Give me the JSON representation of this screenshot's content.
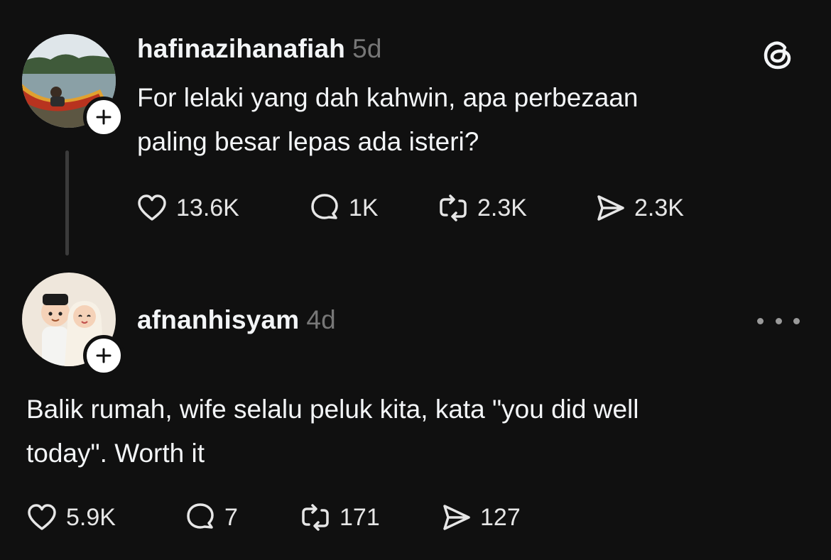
{
  "posts": [
    {
      "username": "hafinazihanafiah",
      "time": "5d",
      "text_lines": [
        "For lelaki yang dah kahwin, apa perbezaan",
        "paling besar lepas ada isteri?"
      ],
      "likes": "13.6K",
      "replies": "1K",
      "reposts": "2.3K",
      "shares": "2.3K"
    },
    {
      "username": "afnanhisyam",
      "time": "4d",
      "text_lines": [
        "Balik rumah, wife selalu peluk kita, kata \"you did well",
        "today\". Worth it"
      ],
      "likes": "5.9K",
      "replies": "7",
      "reposts": "171",
      "shares": "127"
    }
  ],
  "icons": {
    "app_logo": "threads-logo-icon",
    "like": "heart-icon",
    "reply": "comment-bubble-icon",
    "repost": "repost-icon",
    "share": "send-icon",
    "follow": "plus-icon",
    "more": "more-horizontal-icon"
  },
  "colors": {
    "background": "#101010",
    "text_primary": "#f3f5f7",
    "text_secondary": "#777777",
    "thread_line": "#3b3b3b"
  }
}
